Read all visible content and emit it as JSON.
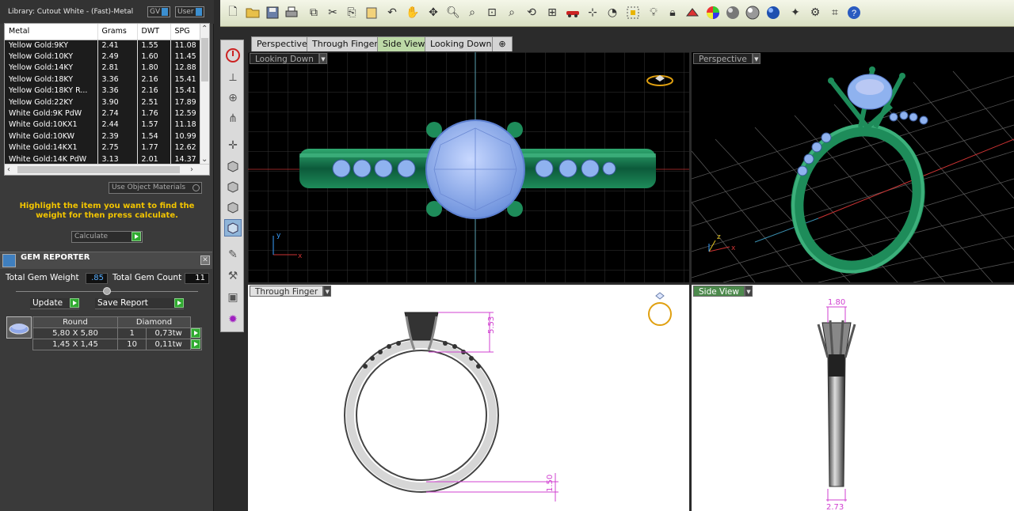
{
  "library": {
    "title": "Library: Cutout White - (Fast)-Metal",
    "gv_label": "GV",
    "user_label": "User"
  },
  "metal_table": {
    "columns": [
      "Metal",
      "Grams",
      "DWT",
      "SPG"
    ],
    "rows": [
      [
        "Yellow Gold:9KY",
        "2.41",
        "1.55",
        "11.08"
      ],
      [
        "Yellow Gold:10KY",
        "2.49",
        "1.60",
        "11.45"
      ],
      [
        "Yellow Gold:14KY",
        "2.81",
        "1.80",
        "12.88"
      ],
      [
        "Yellow Gold:18KY",
        "3.36",
        "2.16",
        "15.41"
      ],
      [
        "Yellow Gold:18KY R...",
        "3.36",
        "2.16",
        "15.41"
      ],
      [
        "Yellow Gold:22KY",
        "3.90",
        "2.51",
        "17.89"
      ],
      [
        "White Gold:9K PdW",
        "2.74",
        "1.76",
        "12.59"
      ],
      [
        "White Gold:10KX1",
        "2.44",
        "1.57",
        "11.18"
      ],
      [
        "White Gold:10KW",
        "2.39",
        "1.54",
        "10.99"
      ],
      [
        "White Gold:14KX1",
        "2.75",
        "1.77",
        "12.62"
      ],
      [
        "White Gold:14K PdW",
        "3.13",
        "2.01",
        "14.37"
      ]
    ]
  },
  "use_object_materials": "Use Object Materials",
  "hint": "Highlight the item you want to find the weight for then press calculate.",
  "calculate_label": "Calculate",
  "gem_reporter": {
    "title": "GEM REPORTER",
    "total_weight_label": "Total Gem Weight",
    "total_weight_value": ".85",
    "total_count_label": "Total Gem Count",
    "total_count_value": "11",
    "update_label": "Update",
    "save_report_label": "Save Report",
    "table_headers": [
      "Round",
      "Diamond"
    ],
    "rows": [
      [
        "5,80 X 5,80",
        "1",
        "0,73tw"
      ],
      [
        "1,45 X 1,45",
        "10",
        "0,11tw"
      ]
    ]
  },
  "tabs": [
    "Perspective",
    "Through Finger",
    "Side View",
    "Looking Down"
  ],
  "active_tab": "Side View",
  "viewports": {
    "top_left": "Looking Down",
    "top_right": "Perspective",
    "bottom_left": "Through Finger",
    "bottom_right": "Side View"
  },
  "dimensions": {
    "head_height": "5.53",
    "shank_height": "1.50",
    "top_width": "1.80",
    "base_width": "2.73"
  },
  "axes": {
    "x": "x",
    "y": "y",
    "z": "z"
  },
  "colors": {
    "metal_green": "#1e8c5a",
    "gem_blue": "#8fb2ef",
    "panel_dark": "#3a3a3a",
    "accent_yellow": "#f2c400",
    "dimension_magenta": "#d040d0"
  }
}
